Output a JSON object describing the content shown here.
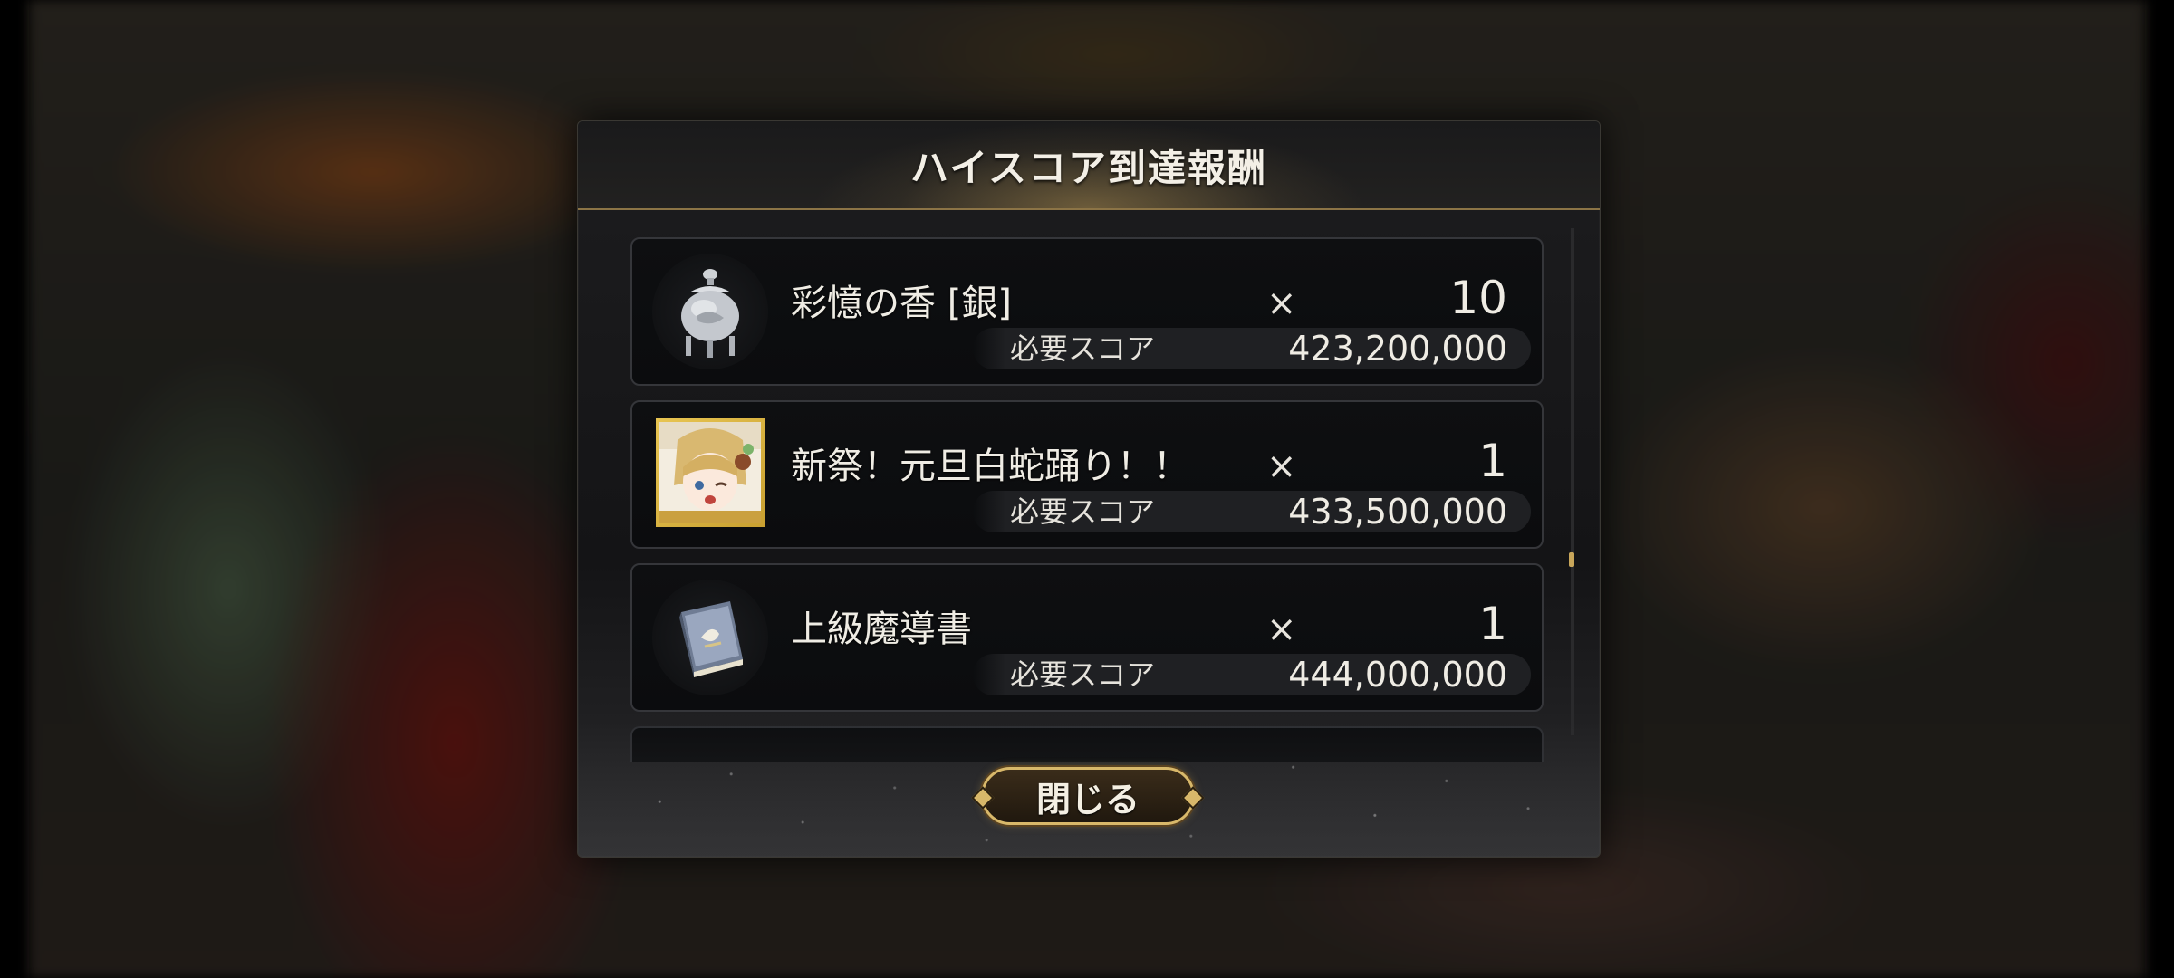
{
  "dialog": {
    "title": "ハイスコア到達報酬",
    "close_label": "閉じる"
  },
  "rewards": [
    {
      "name": "彩憶の香 [銀]",
      "times": "×",
      "quantity": "10",
      "score_label": "必要スコア",
      "score": "423,200,000",
      "icon": "silver-incense-burner-icon"
    },
    {
      "name": "新祭！元旦白蛇踊り！！",
      "times": "×",
      "quantity": "1",
      "score_label": "必要スコア",
      "score": "433,500,000",
      "icon": "character-card-thumbnail"
    },
    {
      "name": "上級魔導書",
      "times": "×",
      "quantity": "1",
      "score_label": "必要スコア",
      "score": "444,000,000",
      "icon": "grimoire-book-icon"
    }
  ],
  "colors": {
    "accent_gold": "#d8b86a",
    "panel_bg": "#141416",
    "item_border": "#35363a"
  }
}
